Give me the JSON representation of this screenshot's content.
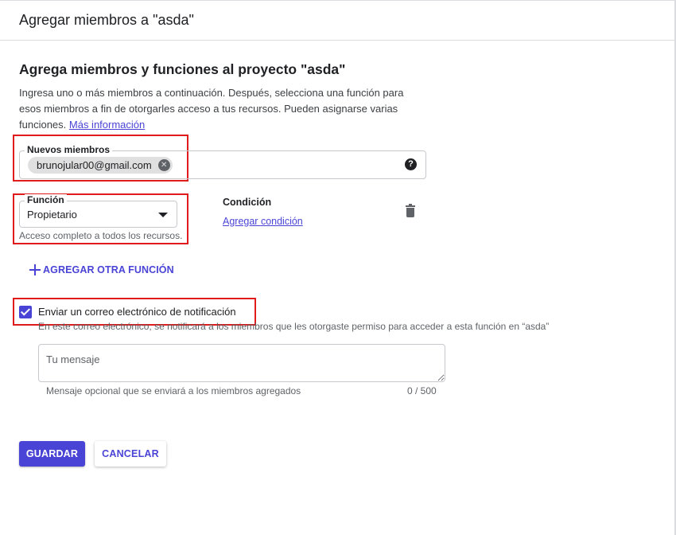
{
  "dialog": {
    "title": "Agregar miembros a \"asda\""
  },
  "section": {
    "title": "Agrega miembros y funciones al proyecto \"asda\"",
    "description": "Ingresa uno o más miembros a continuación. Después, selecciona una función para esos miembros a fin de otorgarles acceso a tus recursos. Pueden asignarse varias funciones.",
    "learn_more": "Más información"
  },
  "members": {
    "label": "Nuevos miembros",
    "chips": [
      "brunojular00@gmail.com"
    ],
    "chip_remove_icon": "cancel-icon",
    "help_icon": "help-icon"
  },
  "role": {
    "label": "Función",
    "value": "Propietario",
    "help": "Acceso completo a todos los recursos.",
    "dropdown_icon": "arrow-drop-down-icon"
  },
  "condition": {
    "label": "Condición",
    "link": "Agregar condición"
  },
  "delete_icon": "trash-icon",
  "add_role": {
    "icon": "plus-icon",
    "label": "AGREGAR OTRA FUNCIÓN"
  },
  "notification": {
    "checked": true,
    "label": "Enviar un correo electrónico de notificación",
    "help": "En este correo electrónico, se notificará a los miembros que les otorgaste permiso para acceder a esta función en “asda”"
  },
  "message": {
    "placeholder": "Tu mensaje",
    "value": "",
    "help": "Mensaje opcional que se enviará a los miembros agregados",
    "counter": "0 / 500"
  },
  "actions": {
    "save": "GUARDAR",
    "cancel": "CANCELAR"
  },
  "colors": {
    "accent": "#4a44d6",
    "highlight": "#e01b1b",
    "border": "#dadce0"
  }
}
